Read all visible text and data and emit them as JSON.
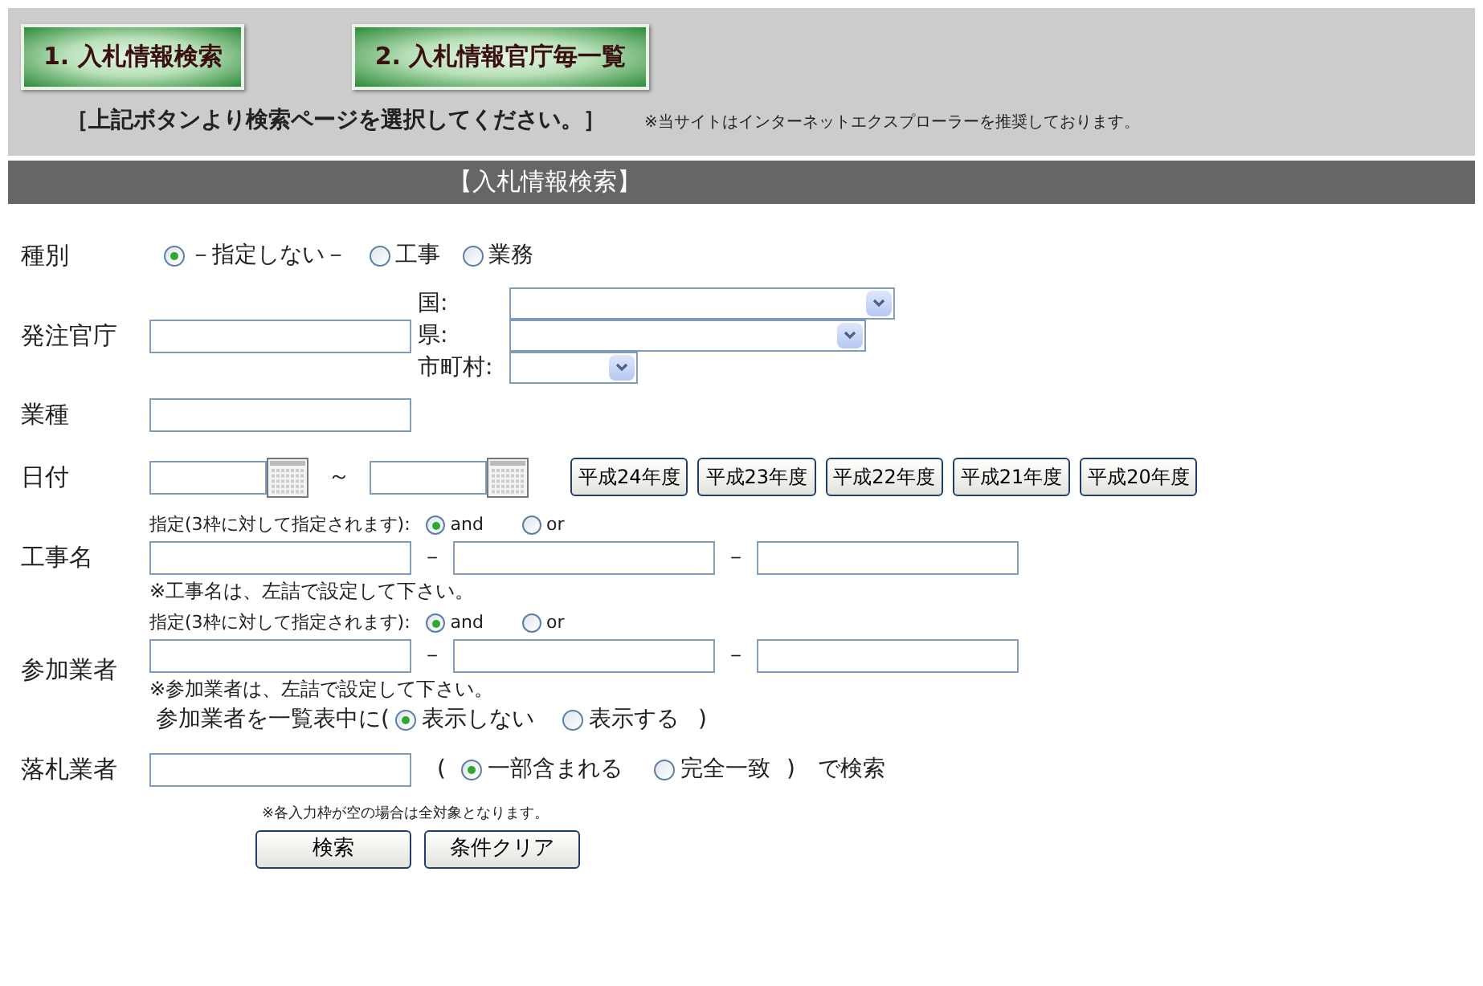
{
  "top_buttons": [
    {
      "label": "1. 入札情報検索"
    },
    {
      "label": "2. 入札情報官庁毎一覧"
    }
  ],
  "instruction": "［上記ボタンより検索ページを選択してください。］",
  "browser_note": "※当サイトはインターネットエクスプローラーを推奨しております。",
  "section_title": "【入札情報検索】",
  "form": {
    "type": {
      "label": "種別",
      "options": [
        {
          "label": "－指定しない－",
          "selected": true
        },
        {
          "label": "工事",
          "selected": false
        },
        {
          "label": "業務",
          "selected": false
        }
      ]
    },
    "agency": {
      "label": "発注官庁",
      "selects": [
        {
          "label": "国:"
        },
        {
          "label": "県:"
        },
        {
          "label": "市町村:"
        }
      ]
    },
    "industry": {
      "label": "業種"
    },
    "date": {
      "label": "日付",
      "separator": "～",
      "year_buttons": [
        "平成24年度",
        "平成23年度",
        "平成22年度",
        "平成21年度",
        "平成20年度"
      ]
    },
    "work_name": {
      "label": "工事名",
      "mode_hint": "指定(3枠に対して指定されます):",
      "modes": [
        {
          "label": "and",
          "selected": true
        },
        {
          "label": "or",
          "selected": false
        }
      ],
      "separators": [
        "－",
        "－"
      ],
      "note": "※工事名は、左詰で設定して下さい。"
    },
    "bidders": {
      "label": "参加業者",
      "mode_hint": "指定(3枠に対して指定されます):",
      "modes": [
        {
          "label": "and",
          "selected": true
        },
        {
          "label": "or",
          "selected": false
        }
      ],
      "separators": [
        "－",
        "－"
      ],
      "note": "※参加業者は、左詰で設定して下さい。",
      "display_prefix": "参加業者を一覧表中に(",
      "display_options": [
        {
          "label": "表示しない",
          "selected": true
        },
        {
          "label": "表示する",
          "selected": false
        }
      ],
      "display_suffix": ")"
    },
    "winner": {
      "label": "落札業者",
      "open": "(",
      "match_options": [
        {
          "label": "一部含まれる",
          "selected": true
        },
        {
          "label": "完全一致",
          "selected": false
        }
      ],
      "close": ")",
      "suffix": "で検索"
    },
    "empty_note": "※各入力枠が空の場合は全対象となります。",
    "buttons": [
      "検索",
      "条件クリア"
    ]
  }
}
